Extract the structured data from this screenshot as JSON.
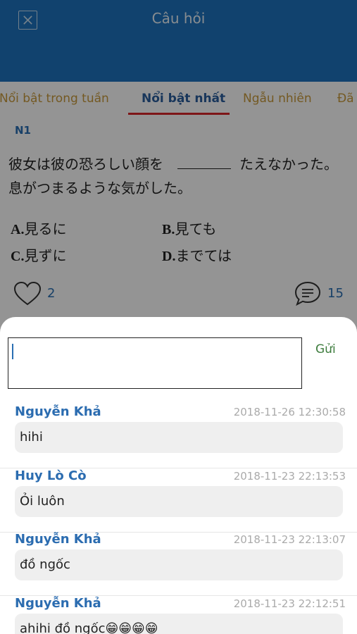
{
  "header": {
    "title": "Câu hỏi"
  },
  "tabs": [
    {
      "label": "Nổi bật trong tuần",
      "active": false
    },
    {
      "label": "Nổi bật nhất",
      "active": true
    },
    {
      "label": "Ngẫu nhiên",
      "active": false
    },
    {
      "label": "Đã",
      "active": false
    }
  ],
  "question": {
    "level": "N1",
    "text_before": "彼女は彼の恐ろしい顔を",
    "text_after": "たえなかった。息がつまるような気がした。",
    "answers": [
      {
        "key": "A.",
        "text": "見るに"
      },
      {
        "key": "B.",
        "text": "見ても"
      },
      {
        "key": "C.",
        "text": "見ずに"
      },
      {
        "key": "D.",
        "text": "までては"
      }
    ],
    "likes": "2",
    "comments_count": "15"
  },
  "comment_box": {
    "placeholder": "",
    "send_label": "Gửi"
  },
  "comments": [
    {
      "author": "Nguyễn Khả",
      "time": "2018-11-26 12:30:58",
      "text": "hihi"
    },
    {
      "author": "Huy Lò Cò",
      "time": "2018-11-23 22:13:53",
      "text": "Ỏi luôn"
    },
    {
      "author": "Nguyễn Khả",
      "time": "2018-11-23 22:13:07",
      "text": "đồ ngốc"
    },
    {
      "author": "Nguyễn Khả",
      "time": "2018-11-23 22:12:51",
      "text": "ahihi đồ ngốc😁😁😁😁"
    }
  ],
  "colors": {
    "header": "#1e73be",
    "tab_active": "#2a5e9e",
    "tab_inactive": "#c89a3c",
    "tab_indicator": "#d9262a",
    "author": "#2b6cb0",
    "send": "#3f7d3f"
  },
  "icons": {
    "close": "close-icon",
    "like": "heart-icon",
    "comment": "comment-bubble-icon"
  }
}
